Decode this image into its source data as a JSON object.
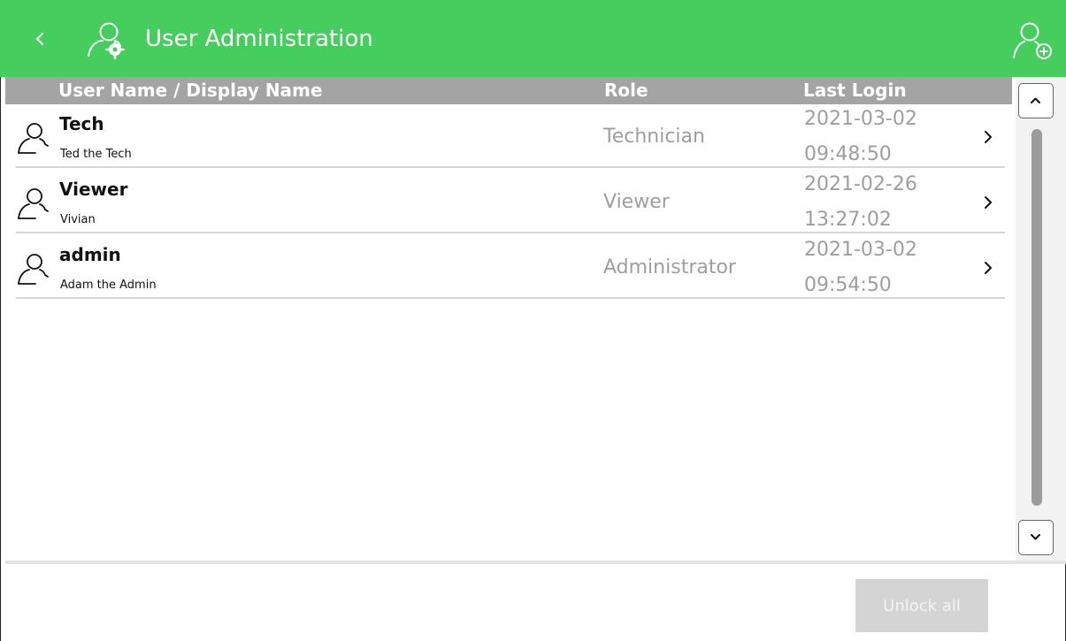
{
  "header": {
    "title": "User Administration",
    "back_icon": "chevron-left-icon",
    "title_icon": "user-settings-icon",
    "add_user_icon": "user-add-icon",
    "color": "#45cd5e"
  },
  "columns": {
    "user": "User Name / Display Name",
    "role": "Role",
    "last_login": "Last Login",
    "header_color": "#a4a4a4"
  },
  "users": [
    {
      "username": "Tech",
      "display_name": "Ted the Tech",
      "role": "Technician",
      "last_login_date": "2021-03-02",
      "last_login_time": "09:48:50"
    },
    {
      "username": "Viewer",
      "display_name": "Vivian",
      "role": "Viewer",
      "last_login_date": "2021-02-26",
      "last_login_time": "13:27:02"
    },
    {
      "username": "admin",
      "display_name": "Adam the Admin",
      "role": "Administrator",
      "last_login_date": "2021-03-02",
      "last_login_time": "09:54:50"
    }
  ],
  "footer": {
    "unlock_all_label": "Unlock all"
  }
}
